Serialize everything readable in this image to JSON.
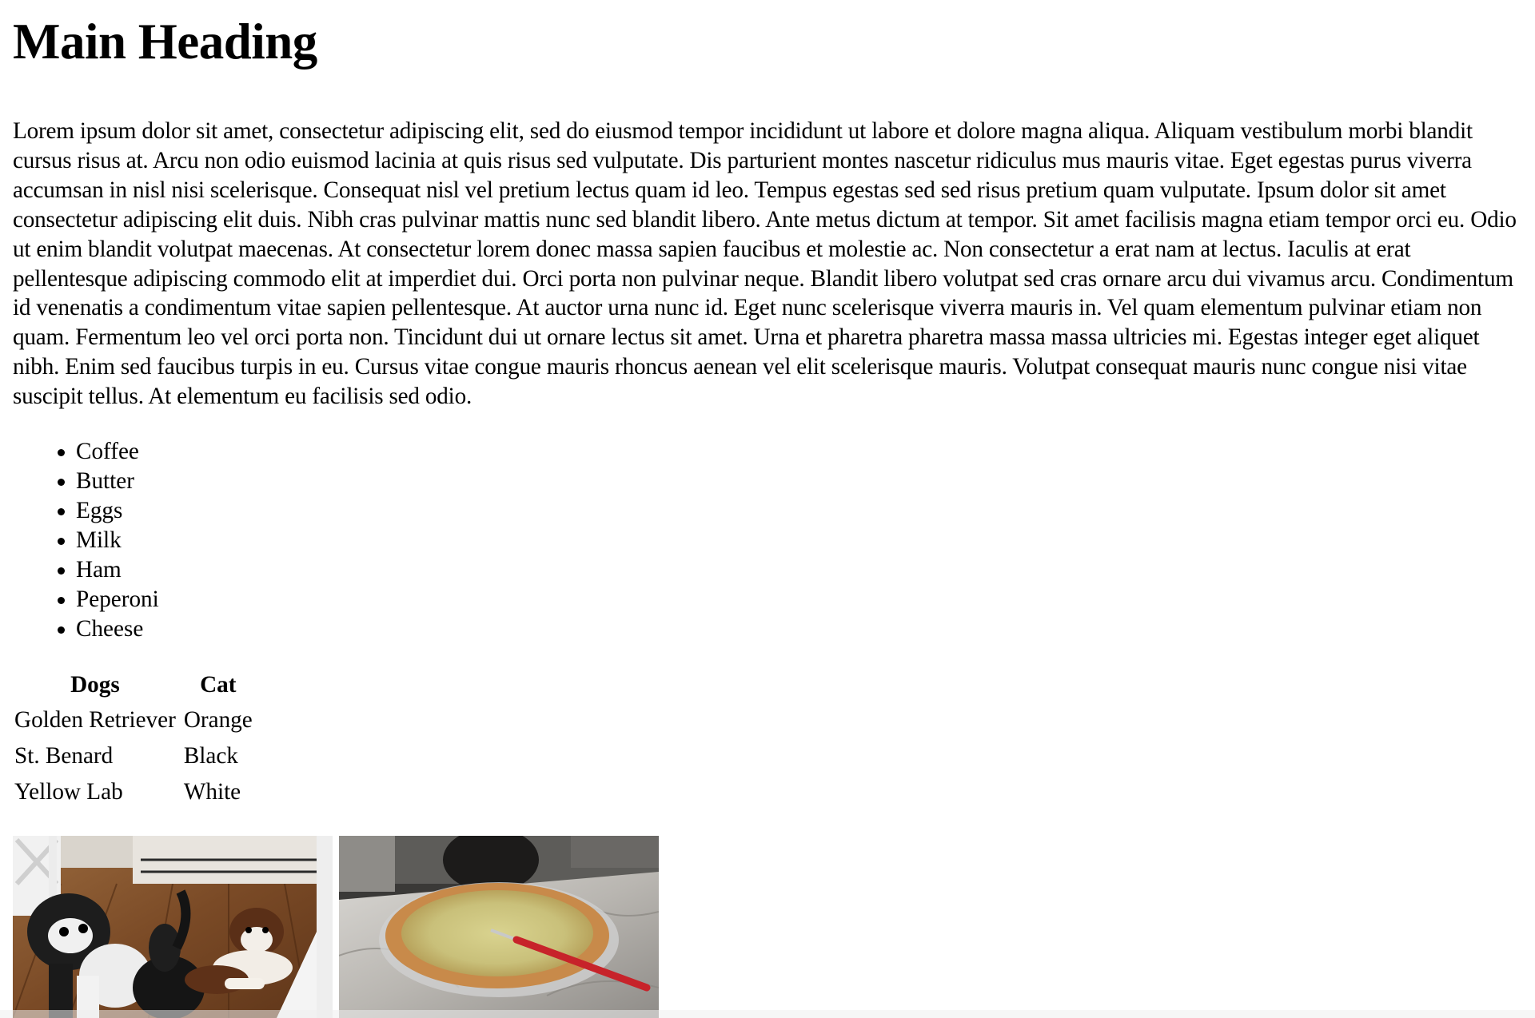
{
  "main": {
    "heading": "Main Heading",
    "paragraph": "Lorem ipsum dolor sit amet, consectetur adipiscing elit, sed do eiusmod tempor incididunt ut labore et dolore magna aliqua. Aliquam vestibulum morbi blandit cursus risus at. Arcu non odio euismod lacinia at quis risus sed vulputate. Dis parturient montes nascetur ridiculus mus mauris vitae. Eget egestas purus viverra accumsan in nisl nisi scelerisque. Consequat nisl vel pretium lectus quam id leo. Tempus egestas sed sed risus pretium quam vulputate. Ipsum dolor sit amet consectetur adipiscing elit duis. Nibh cras pulvinar mattis nunc sed blandit libero. Ante metus dictum at tempor. Sit amet facilisis magna etiam tempor orci eu. Odio ut enim blandit volutpat maecenas. At consectetur lorem donec massa sapien faucibus et molestie ac. Non consectetur a erat nam at lectus. Iaculis at erat pellentesque adipiscing commodo elit at imperdiet dui. Orci porta non pulvinar neque. Blandit libero volutpat sed cras ornare arcu dui vivamus arcu. Condimentum id venenatis a condimentum vitae sapien pellentesque. At auctor urna nunc id. Eget nunc scelerisque viverra mauris in. Vel quam elementum pulvinar etiam non quam. Fermentum leo vel orci porta non. Tincidunt dui ut ornare lectus sit amet. Urna et pharetra pharetra massa massa ultricies mi. Egestas integer eget aliquet nibh. Enim sed faucibus turpis in eu. Cursus vitae congue mauris rhoncus aenean vel elit scelerisque mauris. Volutpat consequat mauris nunc congue nisi vitae suscipit tellus. At elementum eu facilisis sed odio.",
    "list": [
      "Coffee",
      "Butter",
      "Eggs",
      "Milk",
      "Ham",
      "Peperoni",
      "Cheese"
    ],
    "table": {
      "headers": [
        "Dogs",
        "Cat"
      ],
      "rows": [
        [
          "Golden Retriever",
          "Orange"
        ],
        [
          "St. Benard",
          "Black"
        ],
        [
          "Yellow Lab",
          "White"
        ]
      ]
    },
    "images": [
      {
        "subject": "dogs-photo-icon"
      },
      {
        "subject": "pie-photo-icon"
      }
    ]
  }
}
